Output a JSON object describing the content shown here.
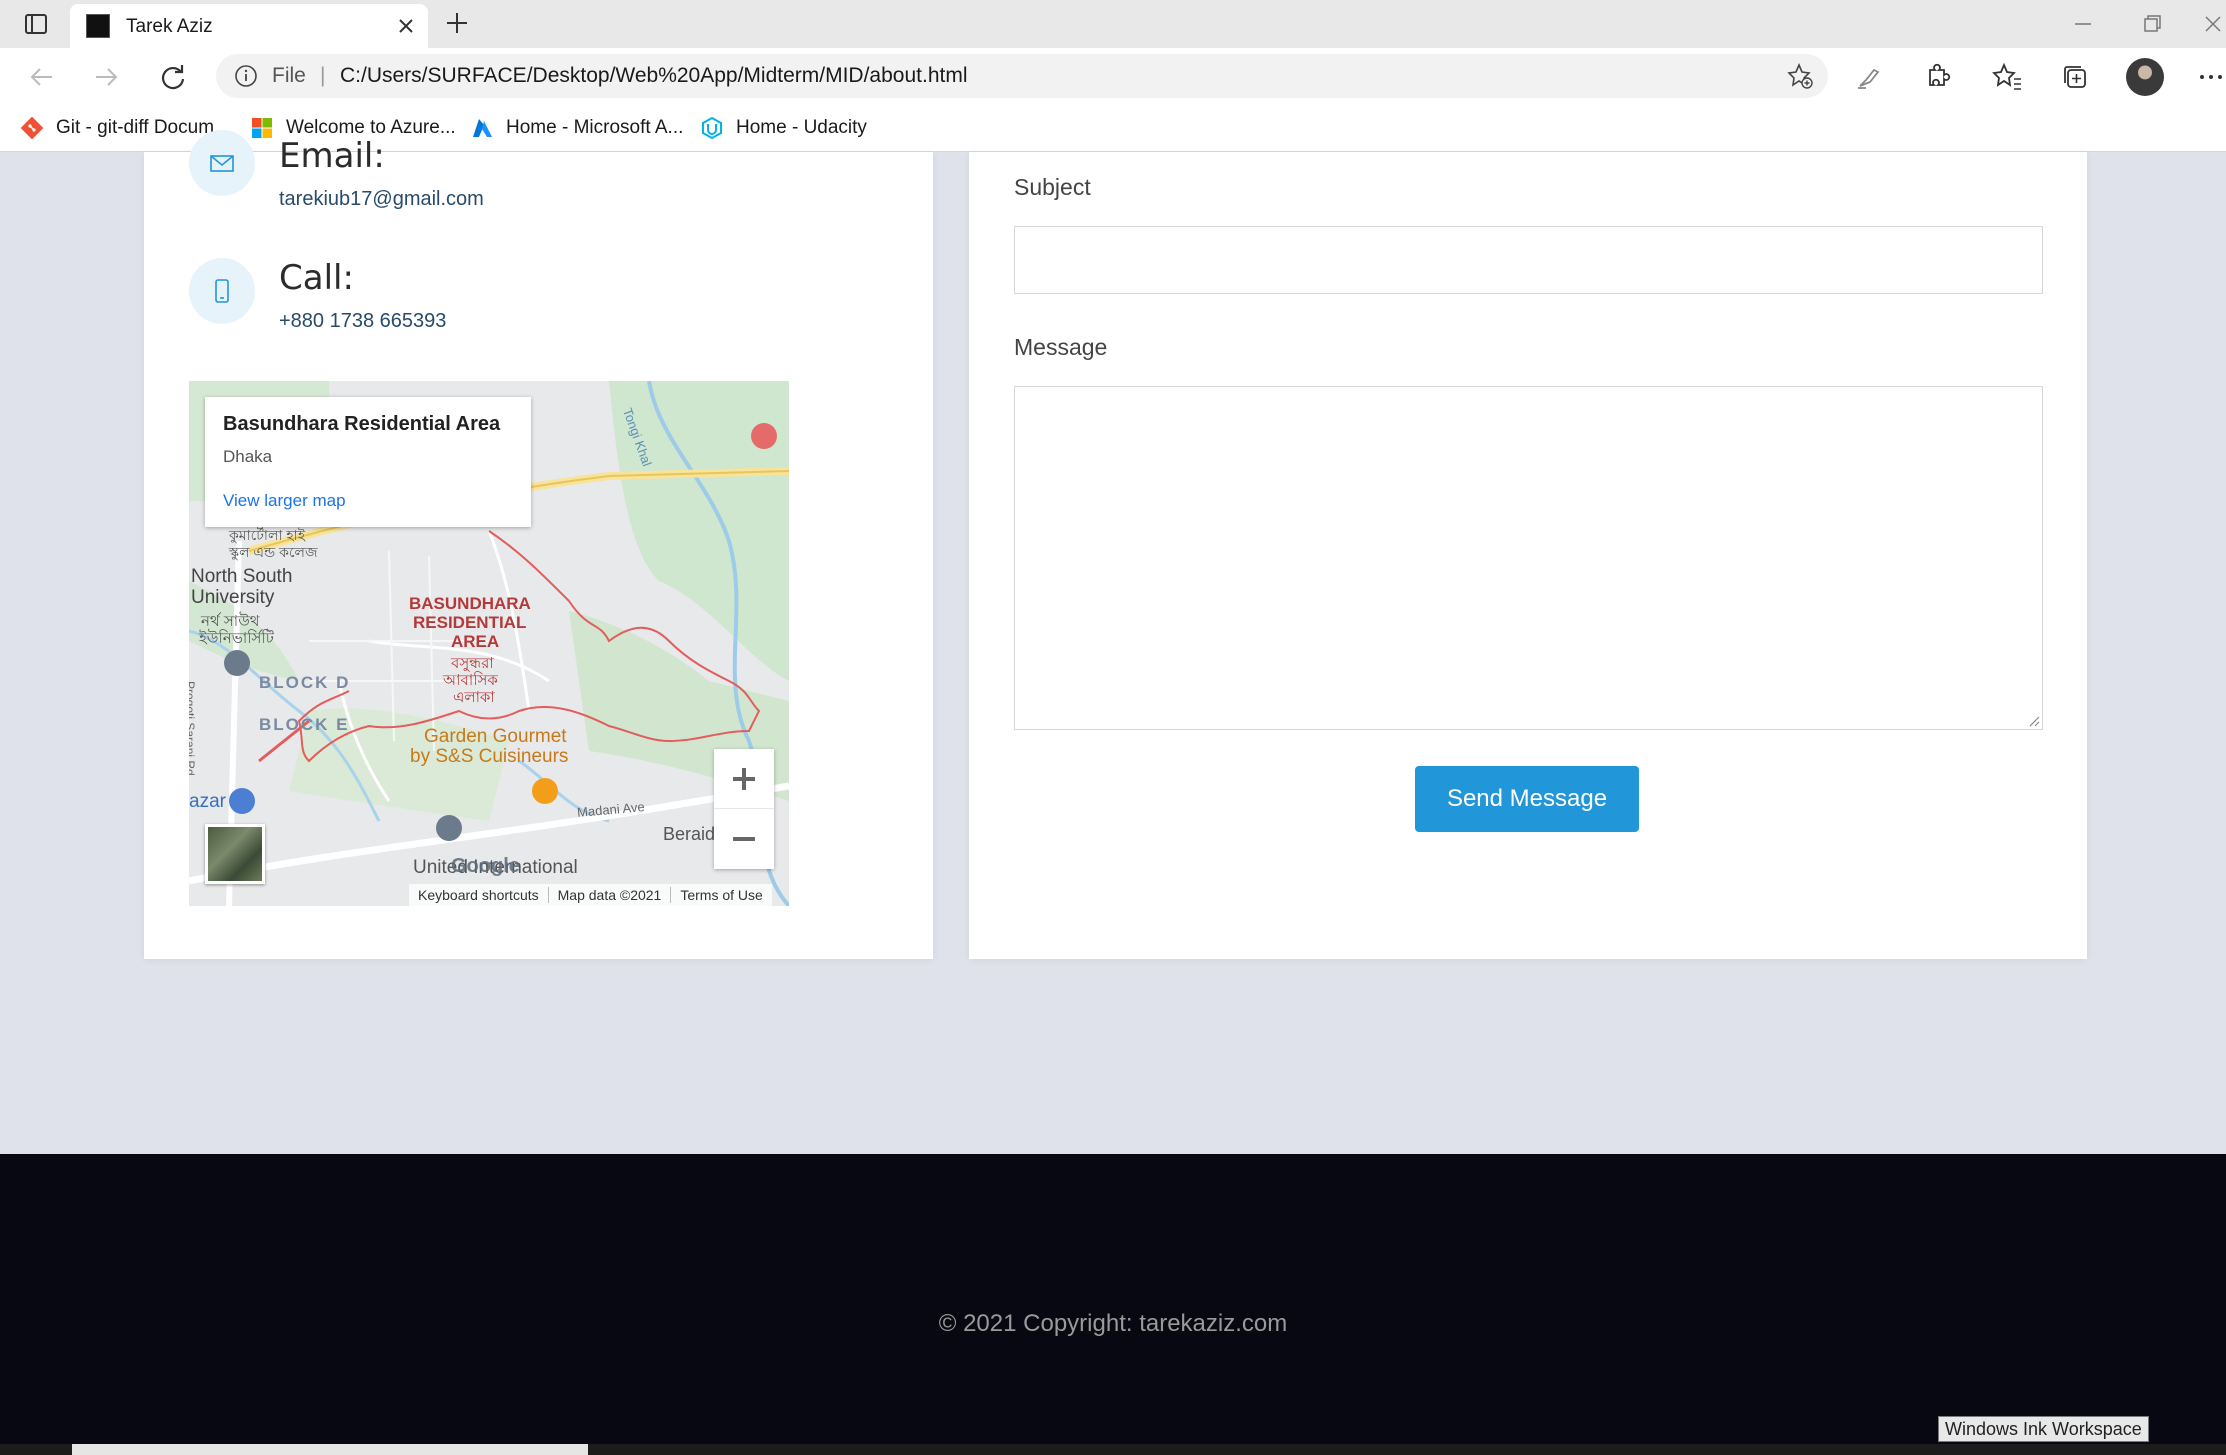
{
  "browser": {
    "tab_title": "Tarek Aziz",
    "address_scheme": "File",
    "address_url": "C:/Users/SURFACE/Desktop/Web%20App/Midterm/MID/about.html",
    "bookmarks": [
      {
        "label": "Git - git-diff Docum...",
        "icon": "git-icon"
      },
      {
        "label": "Welcome to Azure...",
        "icon": "microsoft-icon"
      },
      {
        "label": "Home - Microsoft A...",
        "icon": "azure-icon"
      },
      {
        "label": "Home - Udacity",
        "icon": "udacity-icon"
      }
    ]
  },
  "contact": {
    "email_title": "Email:",
    "email_value": "tarekiub17@gmail.com",
    "call_title": "Call:",
    "call_value": "+880 1738 665393"
  },
  "map": {
    "place_name": "Basundhara Residential Area",
    "city": "Dhaka",
    "view_larger": "View larger map",
    "labels": {
      "north_south_bn": "কুমার্টোলা হাই",
      "school_bn": "স্কুল এন্ড কলেজ",
      "north_south_1": "North South",
      "north_south_2": "University",
      "nsu_bn_1": "নর্থ সাউথ",
      "nsu_bn_2": "ইউনিভার্সিটি",
      "area_1": "BASUNDHARA",
      "area_2": "RESIDENTIAL",
      "area_3": "AREA",
      "area_bn_1": "বসুন্ধরা",
      "area_bn_2": "আবাসিক",
      "area_bn_3": "এলাকা",
      "block_d": "BLOCK D",
      "block_e": "BLOCK E",
      "restaurant_1": "Garden Gourmet",
      "restaurant_2": "by S&S Cuisineurs",
      "tongi_khal": "Tongi Khal",
      "madani_ave": "Madani Ave",
      "beraid": "Beraid",
      "progoti": "Progoti Sarani Rd",
      "bazar": "azar",
      "uni_intl": "United International",
      "google": "Google"
    },
    "footer": [
      "Keyboard shortcuts",
      "Map data ©2021",
      "Terms of Use"
    ]
  },
  "form": {
    "subject_label": "Subject",
    "subject_value": "",
    "message_label": "Message",
    "message_value": "",
    "send_label": "Send Message"
  },
  "footer": {
    "copyright": "© 2021 Copyright: tarekaziz.com"
  },
  "system": {
    "ink_workspace_tooltip": "Windows Ink Workspace"
  },
  "colors": {
    "accent": "#2196d8",
    "page_bg": "#dfe2ea",
    "footer_bg": "#070811"
  }
}
